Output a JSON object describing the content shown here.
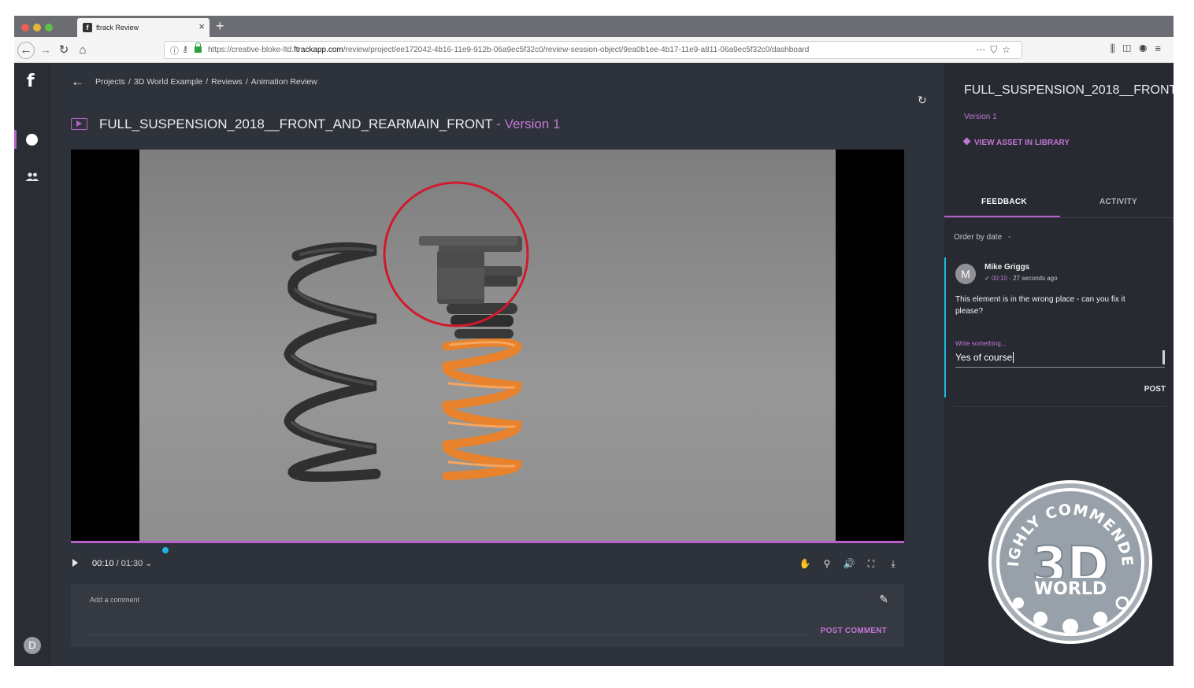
{
  "browser": {
    "tab_title": "ftrack Review",
    "tab_favicon": "f",
    "url_prefix": "https://creative-bloke-ltd.",
    "url_host": "ftrackapp.com",
    "url_path": "/review/project/ee172042-4b16-11e9-912b-06a9ec5f32c0/review-session-object/9ea0b1ee-4b17-11e9-a811-06a9ec5f32c0/dashboard"
  },
  "app": {
    "logo": "f",
    "user_initial": "D"
  },
  "breadcrumb": [
    "Projects",
    "3D World Example",
    "Reviews",
    "Animation Review"
  ],
  "asset": {
    "name": "FULL_SUSPENSION_2018__FRONT_AND_REARMAIN_FRONT",
    "separator": " - ",
    "version": "Version 1"
  },
  "player": {
    "current_time": "00:10",
    "duration": "/ 01:30",
    "caret": "⌄",
    "progress_fraction": 0.11
  },
  "comment": {
    "placeholder": "Add a comment",
    "post_label": "POST COMMENT"
  },
  "panel": {
    "title": "FULL_SUSPENSION_2018__FRONT",
    "version": "Version 1",
    "view_asset": "VIEW ASSET IN LIBRARY",
    "tabs": [
      "FEEDBACK",
      "ACTIVITY"
    ],
    "order_label": "Order by date",
    "order_caret": "-"
  },
  "feedback": {
    "author_initial": "M",
    "author": "Mike Griggs",
    "timestamp": "00:10",
    "ago": " - 27 seconds ago",
    "text": "This element is in the wrong place - can you fix it please?",
    "write_label": "Write something...",
    "reply_value": "Yes of course",
    "post_label": "POST"
  },
  "badge": {
    "ring_text": "HIGHLY COMMENDED",
    "big": "3D",
    "word": "WORLD"
  },
  "colors": {
    "accent": "#b561c9",
    "accent_text": "#c277d6",
    "highlight": "#1fb8e0",
    "annotation": "#d01a2c",
    "spring_orange": "#e8822c"
  }
}
